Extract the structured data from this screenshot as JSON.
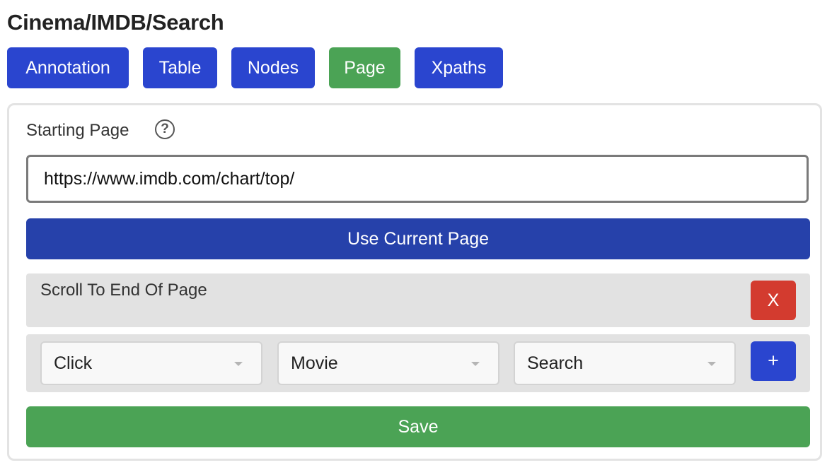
{
  "breadcrumb_title": "Cinema/IMDB/Search",
  "tabs": [
    {
      "label": "Annotation",
      "active": false
    },
    {
      "label": "Table",
      "active": false
    },
    {
      "label": "Nodes",
      "active": false
    },
    {
      "label": "Page",
      "active": true
    },
    {
      "label": "Xpaths",
      "active": false
    }
  ],
  "page": {
    "starting_page_label": "Starting Page",
    "help_icon": "?",
    "url_value": "https://www.imdb.com/chart/top/",
    "use_current_label": "Use Current Page",
    "actions": [
      {
        "text": "Scroll To End Of Page",
        "remove_label": "X"
      }
    ],
    "add_action": {
      "selects": [
        {
          "value": "Click"
        },
        {
          "value": "Movie"
        },
        {
          "value": "Search"
        }
      ],
      "add_label": "+"
    },
    "save_label": "Save"
  },
  "colors": {
    "primary": "#2a45cf",
    "primary_dark": "#2641aa",
    "success": "#4ba355",
    "danger": "#d33b2f"
  }
}
